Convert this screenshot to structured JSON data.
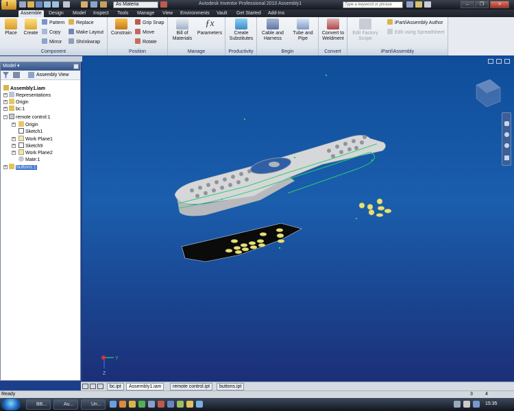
{
  "titlebar": {
    "app_button": "I",
    "material_select": "As Materia",
    "title": "Autodesk Inventor Professional 2010    Assembly1",
    "search_placeholder": "Type a keyword or phrase",
    "minimize": "–",
    "restore": "❐",
    "close": "✕"
  },
  "menu_tabs": [
    "Assemble",
    "Design",
    "Model",
    "Inspect",
    "Tools",
    "Manage",
    "View",
    "Environments",
    "Vault",
    "Get Started",
    "Add-Ins"
  ],
  "ribbon": {
    "component": {
      "place": "Place",
      "create": "Create",
      "pattern": "Pattern",
      "copy": "Copy",
      "mirror": "Mirror",
      "replace": "Replace",
      "make_layout": "Make Layout",
      "shrinkwrap": "Shrinkwrap",
      "label": "Component"
    },
    "position": {
      "constrain": "Constrain",
      "grip_snap": "Grip Snap",
      "move": "Move",
      "rotate": "Rotate",
      "label": "Position"
    },
    "manage": {
      "bom_line1": "Bill of",
      "bom_line2": "Materials",
      "parameters": "Parameters",
      "label": "Manage"
    },
    "productivity": {
      "line1": "Create",
      "line2": "Substitutes",
      "label": "Productivity"
    },
    "begin": {
      "cable_line1": "Cable and",
      "cable_line2": "Harness",
      "tube_line1": "Tube and",
      "tube_line2": "Pipe",
      "label": "Begin"
    },
    "convert": {
      "line1": "Convert to",
      "line2": "Weldment",
      "label": "Convert"
    },
    "ipart": {
      "factory_line1": "Edit Factory",
      "factory_line2": "Scope",
      "author": "iPart/iAssembly Author",
      "spreadsheet": "Edit using Spreadsheet",
      "label": "iPart/iAssembly"
    }
  },
  "browser": {
    "header": "Model ▾",
    "assembly_view": "Assembly View",
    "items": [
      {
        "label": "Assembly1.iam"
      },
      {
        "label": "Representations"
      },
      {
        "label": "Origin"
      },
      {
        "label": "bc:1"
      },
      {
        "label": "remote control:1"
      },
      {
        "label": "Origin"
      },
      {
        "label": "Sketch1"
      },
      {
        "label": "Work Plane1"
      },
      {
        "label": "Sketch9"
      },
      {
        "label": "Work Plane2"
      },
      {
        "label": "Mate:1"
      },
      {
        "label": "buttons:1"
      }
    ]
  },
  "doc_tabs": [
    "bc.ipt",
    "Assembly1.iam",
    "remote control.ipt",
    "buttons.ipt"
  ],
  "status": {
    "left": "Ready",
    "num1": "3",
    "num2": "4"
  },
  "taskbar": {
    "items": [
      "BB...",
      "Au...",
      "Un..."
    ],
    "clock": "15:35"
  },
  "colors": {
    "viewport_top": "#0f4d9a",
    "viewport_bottom": "#1b2f77",
    "part_body": "#d8d8d8",
    "part_base": "#0a0a0a",
    "sketch_line": "#2ecc71",
    "buttons": "#e6e07a"
  }
}
